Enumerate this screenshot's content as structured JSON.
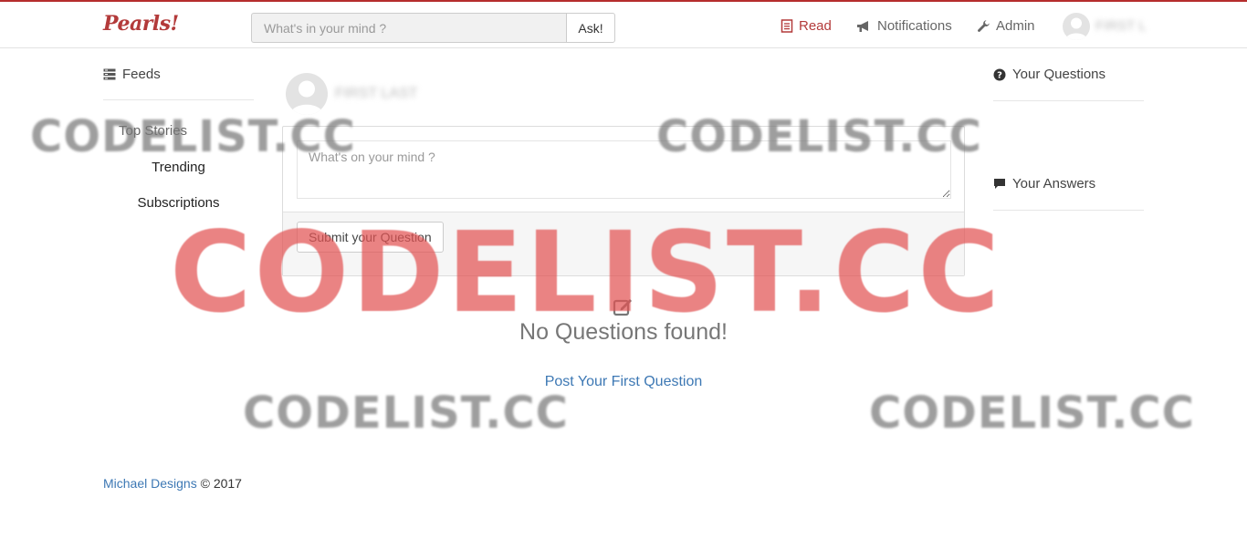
{
  "brand": {
    "name": "Pearls!"
  },
  "search": {
    "placeholder": "What's in your mind ?",
    "button_label": "Ask!"
  },
  "nav": {
    "read_label": "Read",
    "notifications_label": "Notifications",
    "admin_label": "Admin",
    "user_name": "FIRST L"
  },
  "sidebar_left": {
    "feeds_label": "Feeds",
    "top_stories_label": "Top Stories",
    "trending_label": "Trending",
    "subscriptions_label": "Subscriptions"
  },
  "sidebar_right": {
    "questions_label": "Your Questions",
    "answers_label": "Your Answers"
  },
  "composer": {
    "user_name": "FIRST LAST",
    "placeholder": "What's on your mind ?",
    "submit_label": "Submit your Question"
  },
  "empty_state": {
    "title": "No Questions found!",
    "link_label": "Post Your First Question"
  },
  "footer": {
    "link_label": "Michael Designs",
    "copyright": "© 2017"
  },
  "watermark": {
    "text": "CODELIST.CC"
  },
  "colors": {
    "accent": "#b33a3a",
    "link": "#3d78b4",
    "watermark_red": "#e25353",
    "watermark_gray": "#787878"
  }
}
